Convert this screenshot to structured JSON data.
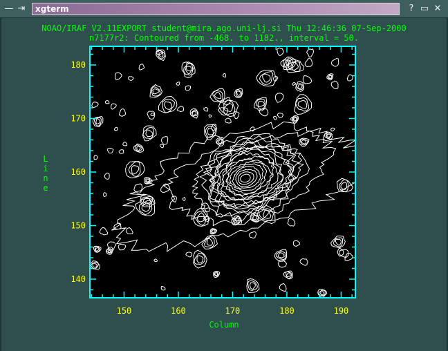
{
  "window": {
    "title": "xgterm",
    "menu_icon": "window-menu-icon",
    "pin_icon": "pin-icon",
    "help_icon": "help-icon",
    "minimize_icon": "minimize-icon",
    "close_icon": "close-icon"
  },
  "plot": {
    "header_line1": "NOAO/IRAF V2.11EXPORT student@mira.ago.uni-lj.si Thu 12:46:36 07-Sep-2000",
    "header_line2": "n7177r2: Contoured from -468. to 1182., interval = 50.",
    "xlabel": "Column",
    "ylabel": "Line",
    "x_ticks": [
      "150",
      "160",
      "170",
      "180",
      "190"
    ],
    "y_ticks": [
      "140",
      "150",
      "160",
      "170",
      "180"
    ],
    "colors": {
      "background": "#2f4f4f",
      "axis": "#00ffff",
      "labels": "#ffff00",
      "header": "#00ff00",
      "contours": "#ffffff",
      "plot_bg": "#000000"
    }
  }
}
